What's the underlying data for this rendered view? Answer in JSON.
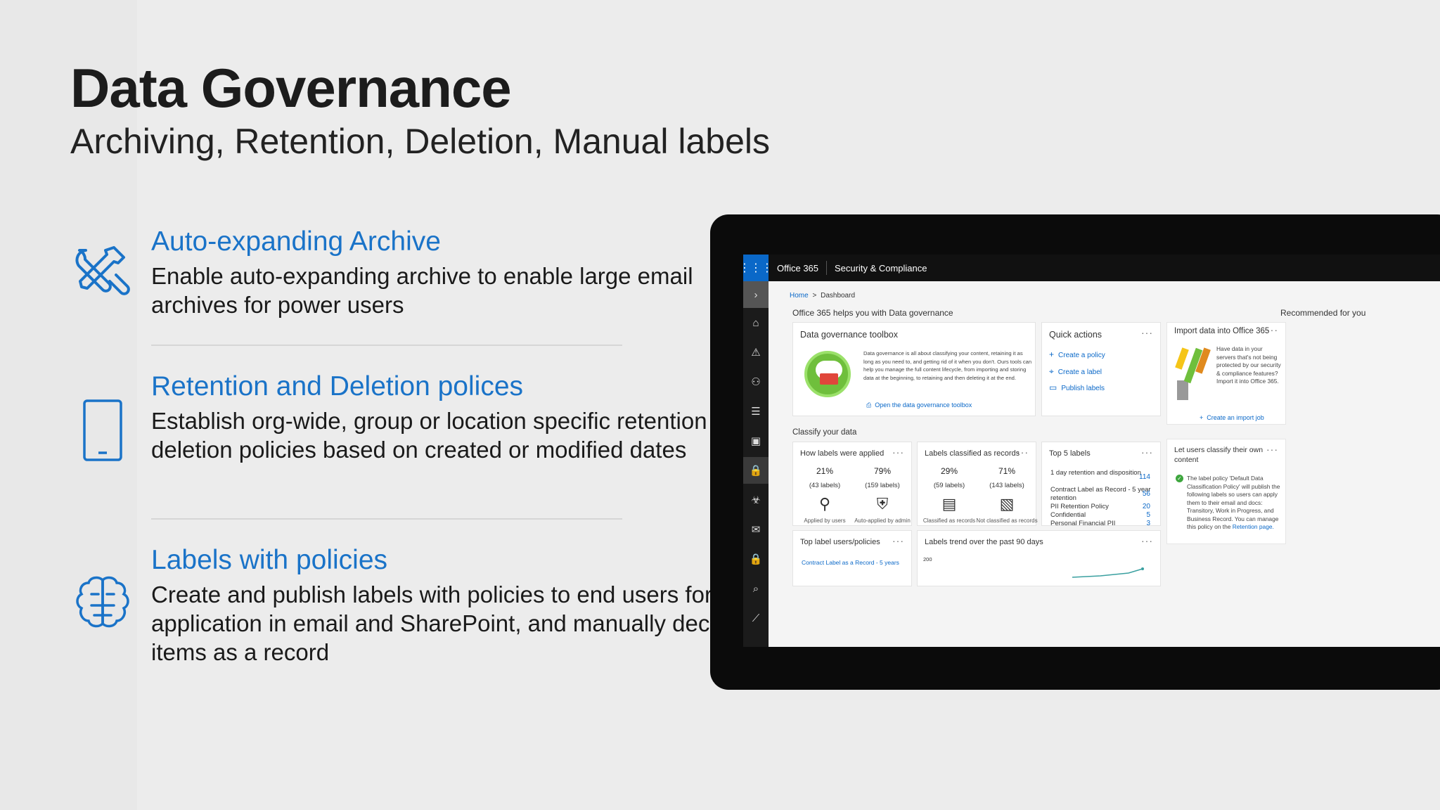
{
  "slide": {
    "title": "Data Governance",
    "subtitle": "Archiving, Retention, Deletion, Manual labels"
  },
  "features": [
    {
      "icon": "tools-icon",
      "heading": "Auto-expanding Archive",
      "text": "Enable auto-expanding archive to enable large email archives for power users"
    },
    {
      "icon": "mobile-device-icon",
      "heading": "Retention and Deletion polices",
      "text": "Establish org-wide, group or location specific retention and deletion policies based on created or modified dates"
    },
    {
      "icon": "brain-icon",
      "heading": "Labels with policies",
      "text": "Create and publish labels with policies to end users for application in email and SharePoint, and manually declare items as a record"
    }
  ],
  "colors": {
    "accent": "#1a73c8",
    "o365_blue": "#0a68c8"
  },
  "app": {
    "topbar": {
      "app_name": "Office 365",
      "section": "Security & Compliance"
    },
    "breadcrumb": {
      "home": "Home",
      "sep": ">",
      "current": "Dashboard"
    },
    "helps_heading": "Office 365 helps you with Data governance",
    "recommended_heading": "Recommended for you",
    "toolbox": {
      "title": "Data governance toolbox",
      "description": "Data governance is all about classifying your content, retaining it as long as you need to, and getting rid of it when you don't. Ours tools can help you manage the full content lifecycle, from importing and storing data at the beginning, to retaining and then deleting it at the end.",
      "link": "Open the data governance toolbox"
    },
    "quick_actions": {
      "title": "Quick actions",
      "items": [
        "Create a policy",
        "Create a label",
        "Publish labels"
      ]
    },
    "import_card": {
      "title": "Import data into Office 365",
      "text": "Have data in your servers that's not being protected by our security & compliance features? Import it into Office 365.",
      "link": "Create an import job"
    },
    "classify_heading": "Classify your data",
    "how_applied": {
      "title": "How labels were applied",
      "stats": [
        {
          "pct": "21%",
          "count": "(43 labels)",
          "caption": "Applied by users"
        },
        {
          "pct": "79%",
          "count": "(159 labels)",
          "caption": "Auto-applied by admin"
        }
      ]
    },
    "classified_records": {
      "title": "Labels classified as records",
      "stats": [
        {
          "pct": "29%",
          "count": "(59 labels)",
          "caption": "Classified as records"
        },
        {
          "pct": "71%",
          "count": "(143 labels)",
          "caption": "Not classified as records"
        }
      ]
    },
    "top5": {
      "title": "Top 5 labels",
      "rows": [
        {
          "label": "1 day retention and disposition",
          "value": "114"
        },
        {
          "label": "Contract Label as Record - 5 year retention",
          "value": "56"
        },
        {
          "label": "PII Retention Policy",
          "value": "20"
        },
        {
          "label": "Confidential",
          "value": "5"
        },
        {
          "label": "Personal Financial PII",
          "value": "3"
        }
      ]
    },
    "user_classify": {
      "title": "Let users classify their own content",
      "text": "The label policy 'Default Data Classification Policy' will publish the following labels so users can apply them to their email and docs: Transitory, Work in Progress, and Business Record.",
      "text2": "You can manage this policy on the",
      "link": "Retention page."
    },
    "top_users": {
      "title": "Top label users/policies",
      "row": "Contract Label as a Record - 5 years"
    },
    "trend": {
      "title": "Labels trend over the past 90 days",
      "y_tick": "200"
    },
    "more": "···"
  }
}
